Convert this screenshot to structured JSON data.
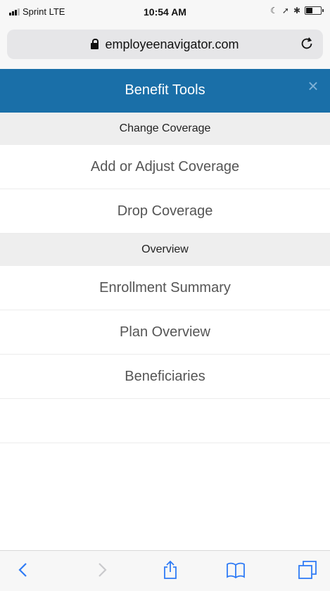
{
  "status_bar": {
    "carrier": "Sprint  LTE",
    "time": "10:54 AM"
  },
  "url_bar": {
    "domain": "employeenavigator.com"
  },
  "header": {
    "title": "Benefit Tools",
    "close_symbol": "×"
  },
  "menu": {
    "sections": [
      {
        "title": "Change Coverage",
        "items": [
          "Add or Adjust Coverage",
          "Drop Coverage"
        ]
      },
      {
        "title": "Overview",
        "items": [
          "Enrollment Summary",
          "Plan Overview",
          "Beneficiaries"
        ]
      }
    ]
  },
  "toolbar": {
    "icons": [
      "back-icon",
      "forward-icon",
      "share-icon",
      "bookmarks-icon",
      "tabs-icon"
    ]
  },
  "colors": {
    "header_bg": "#1a6fa8",
    "section_bg": "#eeeeee",
    "ios_blue": "#2f7bf5"
  }
}
